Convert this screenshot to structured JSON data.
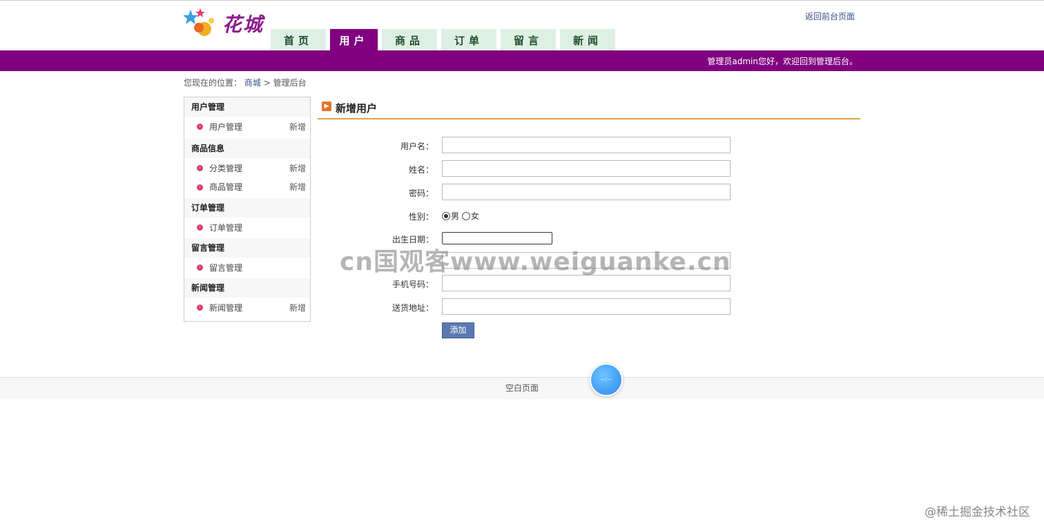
{
  "logo": {
    "text": "花城"
  },
  "header": {
    "back_link": "返回前台页面"
  },
  "nav": {
    "tabs": [
      "首页",
      "用户",
      "商品",
      "订单",
      "留言",
      "新闻"
    ],
    "active_index": 1
  },
  "welcome": "管理员admin您好，欢迎回到管理后台。",
  "breadcrumb": {
    "prefix": "您现在的位置：",
    "link": "商城",
    "sep": ">",
    "current": "管理后台"
  },
  "sidebar": {
    "groups": [
      {
        "title": "用户管理",
        "items": [
          {
            "label": "用户管理",
            "add": "新增"
          }
        ]
      },
      {
        "title": "商品信息",
        "items": [
          {
            "label": "分类管理",
            "add": "新增"
          },
          {
            "label": "商品管理",
            "add": "新增"
          }
        ]
      },
      {
        "title": "订单管理",
        "items": [
          {
            "label": "订单管理",
            "add": ""
          }
        ]
      },
      {
        "title": "留言管理",
        "items": [
          {
            "label": "留言管理",
            "add": ""
          }
        ]
      },
      {
        "title": "新闻管理",
        "items": [
          {
            "label": "新闻管理",
            "add": "新增"
          }
        ]
      }
    ]
  },
  "main": {
    "title": "新增用户",
    "form": {
      "username_label": "用户名：",
      "name_label": "姓名：",
      "password_label": "密码：",
      "gender_label": "性别：",
      "gender_male": "男",
      "gender_female": "女",
      "gender_selected": "男",
      "birthday_label": "出生日期：",
      "phone_label": "手机号码：",
      "address_label": "送货地址：",
      "submit_label": "添加"
    }
  },
  "footer": {
    "text": "空白页面"
  },
  "float_ball": {
    "text": "--:--"
  },
  "watermark": {
    "text": "cn国观客www.weiguanke.cn"
  },
  "corner_watermark": {
    "text": "@稀土掘金技术社区"
  },
  "colors": {
    "purple": "#800080",
    "tab_bg": "#def0e4",
    "button": "#5b79b0",
    "accent_line": "#e0a040"
  }
}
